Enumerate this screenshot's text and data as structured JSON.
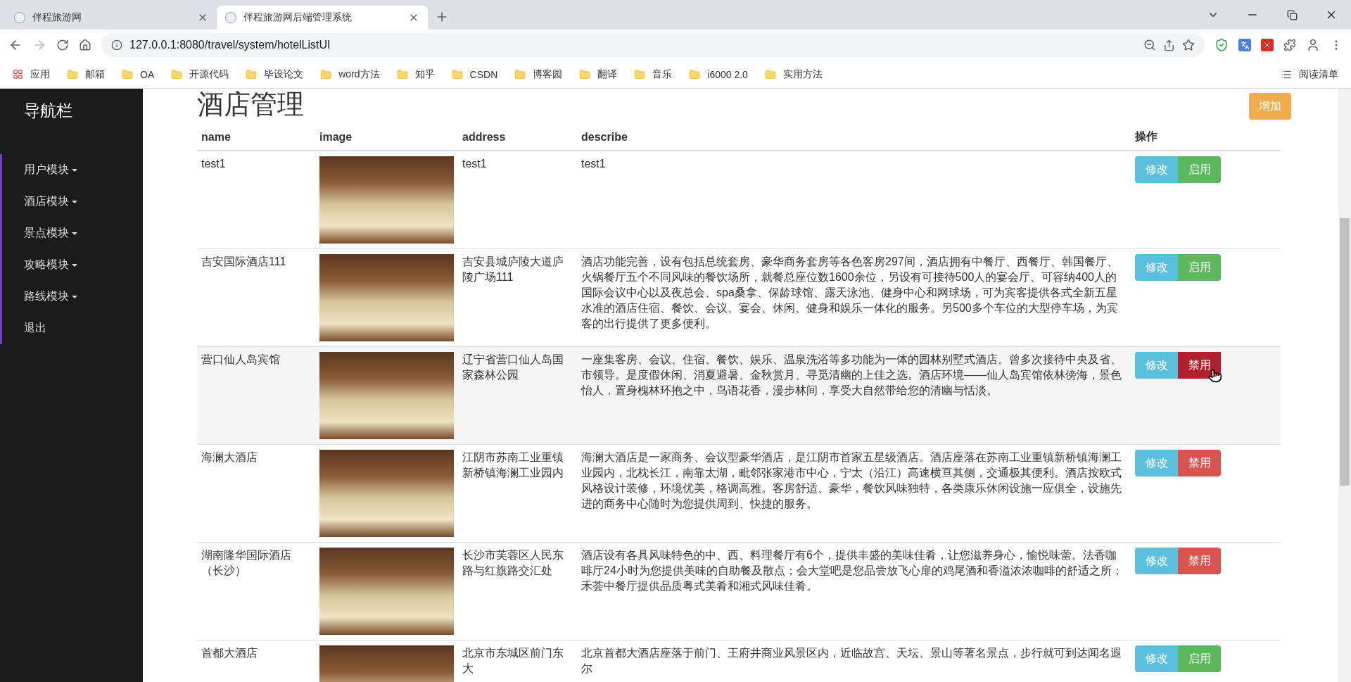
{
  "browser": {
    "tabs": [
      {
        "title": "伴程旅游网",
        "selected": false
      },
      {
        "title": "伴程旅游网后端管理系统",
        "selected": true
      }
    ],
    "address": "127.0.0.1:8080/travel/system/hotelListUI",
    "bookmarks": [
      {
        "label": "应用",
        "kind": "apps"
      },
      {
        "label": "邮箱",
        "kind": "folder"
      },
      {
        "label": "OA",
        "kind": "folder"
      },
      {
        "label": "开源代码",
        "kind": "folder"
      },
      {
        "label": "毕设论文",
        "kind": "folder"
      },
      {
        "label": "word方法",
        "kind": "folder"
      },
      {
        "label": "知乎",
        "kind": "folder"
      },
      {
        "label": "CSDN",
        "kind": "folder"
      },
      {
        "label": "博客园",
        "kind": "folder"
      },
      {
        "label": "翻译",
        "kind": "folder"
      },
      {
        "label": "音乐",
        "kind": "folder"
      },
      {
        "label": "i6000 2.0",
        "kind": "folder"
      },
      {
        "label": "实用方法",
        "kind": "folder"
      }
    ],
    "reading_list": "阅读清单"
  },
  "sidebar": {
    "title": "导航栏",
    "items": [
      {
        "label": "用户模块",
        "dropdown": true
      },
      {
        "label": "酒店模块",
        "dropdown": true
      },
      {
        "label": "景点模块",
        "dropdown": true
      },
      {
        "label": "攻略模块",
        "dropdown": true
      },
      {
        "label": "路线模块",
        "dropdown": true
      },
      {
        "label": "退出",
        "dropdown": false
      }
    ]
  },
  "page": {
    "title": "酒店管理",
    "add_button": "增加"
  },
  "table": {
    "columns": [
      "name",
      "image",
      "address",
      "describe",
      "操作"
    ],
    "rows": [
      {
        "name": "test1",
        "address": "test1",
        "describe": "test1",
        "edit_button": "修改",
        "status_button": {
          "label": "启用",
          "kind": "enable"
        },
        "hovered": false
      },
      {
        "name": "吉安国际酒店111",
        "address": "吉安县城庐陵大道庐陵广场111",
        "describe": "酒店功能完善，设有包括总统套房、豪华商务套房等各色客房297间，酒店拥有中餐厅、西餐厅、韩国餐厅、火锅餐厅五个不同风味的餐饮场所，就餐总座位数1600余位，另设有可接待500人的宴会厅、可容纳400人的国际会议中心以及夜总会、spa桑拿、保龄球馆、露天泳池、健身中心和网球场，可为宾客提供各式全新五星水准的酒店住宿、餐饮、会议、宴会、休闲、健身和娱乐一体化的服务。另500多个车位的大型停车场，为宾客的出行提供了更多便利。",
        "edit_button": "修改",
        "status_button": {
          "label": "启用",
          "kind": "enable"
        },
        "hovered": false
      },
      {
        "name": "营口仙人岛宾馆",
        "address": "辽宁省营口仙人岛国家森林公园",
        "describe": "一座集客房、会议、住宿、餐饮、娱乐、温泉洗浴等多功能为一体的园林别墅式酒店。曾多次接待中央及省、市领导。是度假休闲、消夏避暑、金秋赏月、寻觅清幽的上佳之选。酒店环境——仙人岛宾馆依林傍海，景色怡人，置身槐林环抱之中，鸟语花香，漫步林间，享受大自然带给您的清幽与恬淡。",
        "edit_button": "修改",
        "status_button": {
          "label": "禁用",
          "kind": "disable"
        },
        "hovered": true
      },
      {
        "name": "海澜大酒店",
        "address": "江阴市苏南工业重镇新桥镇海澜工业园内",
        "describe": "海澜大酒店是一家商务、会议型豪华酒店，是江阴市首家五星级酒店。酒店座落在苏南工业重镇新桥镇海澜工业园内，北枕长江，南靠太湖，毗邻张家港市中心，宁太（沿江）高速横亘其侧，交通极其便利。酒店按欧式风格设计装修，环境优美，格调高雅。客房舒适、豪华，餐饮风味独特，各类康乐休闲设施一应俱全，设施先进的商务中心随时为您提供周到、快捷的服务。",
        "edit_button": "修改",
        "status_button": {
          "label": "禁用",
          "kind": "disable"
        },
        "hovered": false
      },
      {
        "name": "湖南隆华国际酒店（长沙）",
        "address": "长沙市芙蓉区人民东路与红旗路交汇处",
        "describe": "酒店设有各具风味特色的中、西、料理餐厅有6个，提供丰盛的美味佳肴，让您滋养身心，愉悦味蕾。法香咖啡厅24小时为您提供美味的自助餐及散点；会大堂吧是您品尝放飞心扉的鸡尾酒和香溢浓浓咖啡的舒适之所；禾荟中餐厅提供品质粤式美肴和湘式风味佳肴。",
        "edit_button": "修改",
        "status_button": {
          "label": "禁用",
          "kind": "disable"
        },
        "hovered": false
      },
      {
        "name": "首都大酒店",
        "address": "北京市东城区前门东大",
        "describe": "北京首都大酒店座落于前门、王府井商业风景区内，近临故宫、天坛、景山等著名景点，步行就可到达闻名遐尔",
        "edit_button": "修改",
        "status_button": {
          "label": "启用",
          "kind": "enable"
        },
        "hovered": false
      }
    ]
  }
}
